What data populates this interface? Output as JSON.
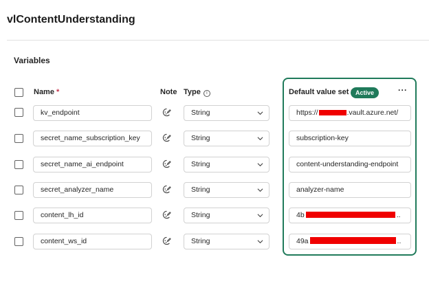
{
  "page": {
    "title": "vlContentUnderstanding",
    "section_title": "Variables"
  },
  "columns": {
    "name": "Name",
    "required_marker": "*",
    "note": "Note",
    "type": "Type",
    "default_value_set": "Default value set",
    "active_badge": "Active",
    "more_options": "···"
  },
  "colors": {
    "accent": "#1f7a5a",
    "required": "#c4314b",
    "redaction": "#f00000"
  },
  "rows": [
    {
      "name": "kv_endpoint",
      "note_icon": "note-icon",
      "type": "String",
      "value": "https://",
      "value_suffix": ".vault.azure.net/"
    },
    {
      "name": "secret_name_subscription_key",
      "note_icon": "note-icon",
      "type": "String",
      "value": "subscription-key"
    },
    {
      "name": "secret_name_ai_endpoint",
      "note_icon": "note-icon",
      "type": "String",
      "value": "content-understanding-endpoint"
    },
    {
      "name": "secret_analyzer_name",
      "note_icon": "note-icon",
      "type": "String",
      "value": "analyzer-name"
    },
    {
      "name": "content_lh_id",
      "note_icon": "note-icon",
      "type": "String",
      "value": "4b",
      "value_suffix": ".."
    },
    {
      "name": "content_ws_id",
      "note_icon": "note-icon",
      "type": "String",
      "value": "49a",
      "value_suffix": ".."
    }
  ]
}
